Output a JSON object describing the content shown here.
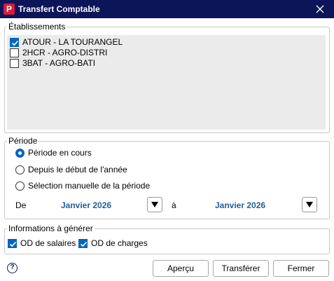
{
  "window": {
    "title": "Transfert Comptable",
    "app_icon_letter": "P"
  },
  "etablissements": {
    "legend": "Établissements",
    "items": [
      {
        "label": "ATOUR - LA TOURANGEL",
        "checked": true
      },
      {
        "label": "2HCR - AGRO-DISTRI",
        "checked": false
      },
      {
        "label": "3BAT - AGRO-BATI",
        "checked": false
      }
    ]
  },
  "periode": {
    "legend": "Période",
    "options": [
      {
        "label": "Période en cours",
        "selected": true
      },
      {
        "label": "Depuis le début de l'année",
        "selected": false
      },
      {
        "label": "Sélection manuelle de la période",
        "selected": false
      }
    ],
    "from_label": "De",
    "from_value": "Janvier 2026",
    "to_label": "à",
    "to_value": "Janvier 2026"
  },
  "informations": {
    "legend": "Informations à générer",
    "items": [
      {
        "label": "OD de salaires",
        "checked": true
      },
      {
        "label": "OD de charges",
        "checked": true
      }
    ]
  },
  "buttons": {
    "preview": "Aperçu",
    "transfer": "Transférer",
    "close": "Fermer"
  },
  "colors": {
    "titlebar": "#0d1559",
    "accent": "#0067c0",
    "date_text": "#1f5f9e",
    "app_icon": "#d81b3c"
  }
}
